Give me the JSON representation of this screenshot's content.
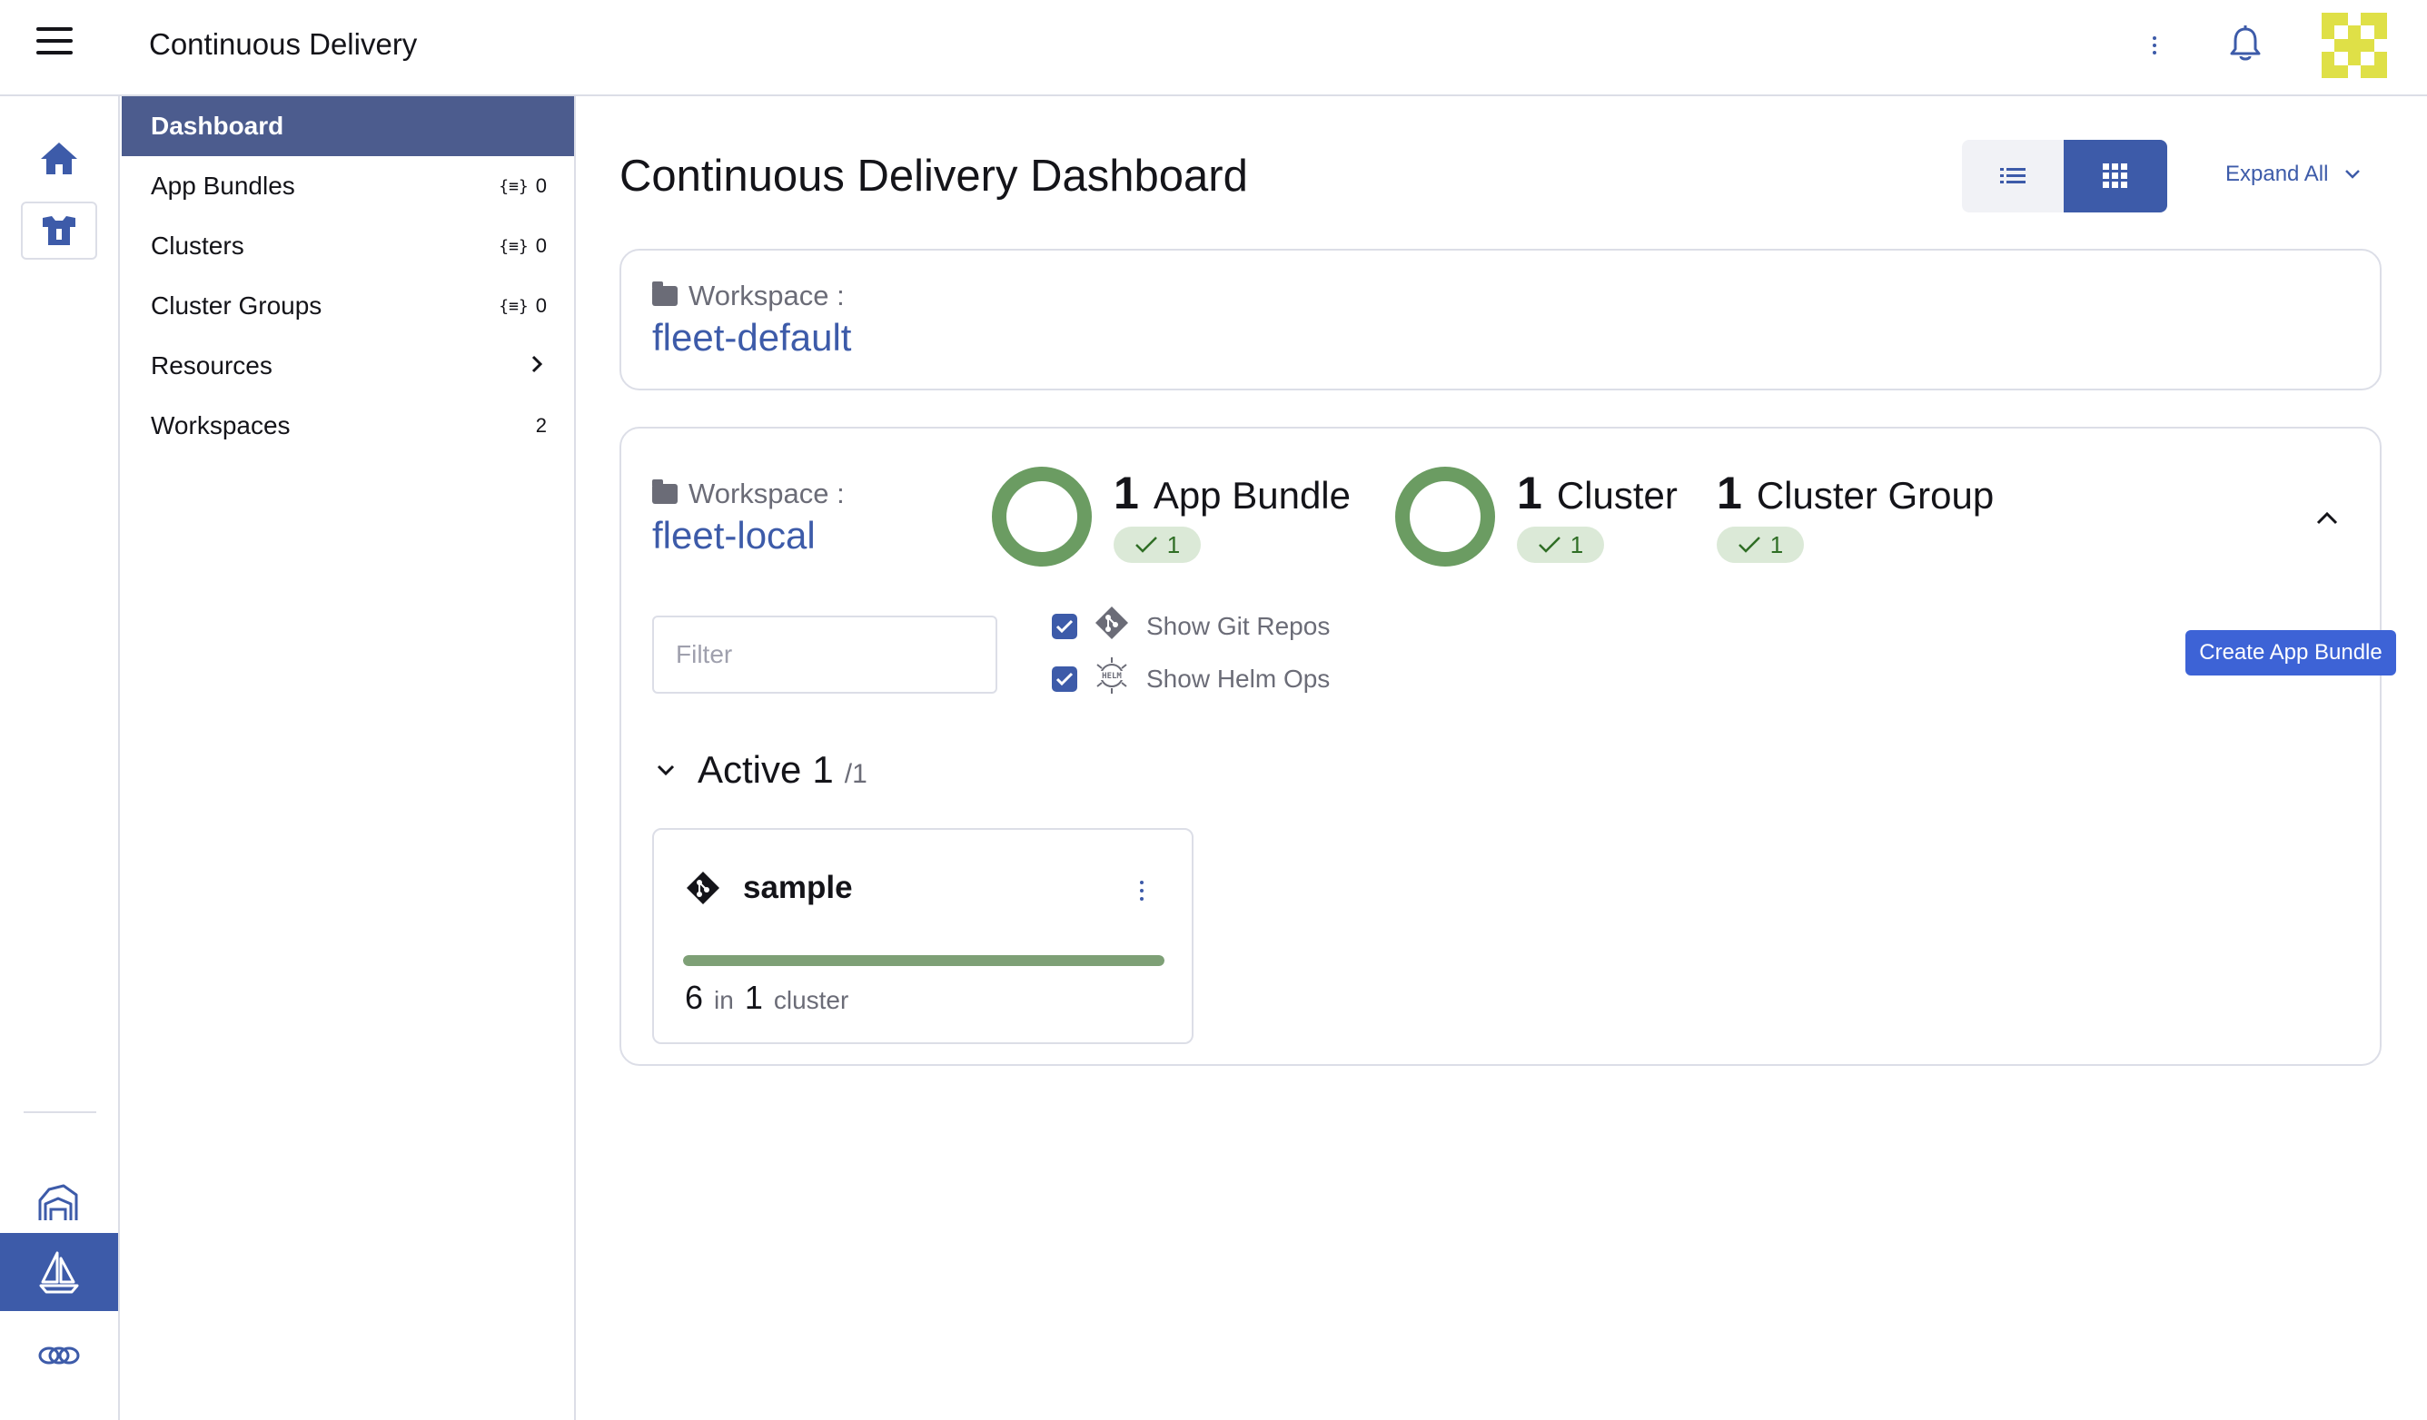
{
  "header": {
    "product_title": "Continuous Delivery",
    "menu_icon": "hamburger-icon",
    "notifications_icon": "bell-icon",
    "avatar_colors": [
      "#dfe047",
      "#ffffff"
    ]
  },
  "rail": {
    "items": [
      {
        "name": "home",
        "icon": "home-icon"
      },
      {
        "name": "fleet",
        "icon": "fleet-icon"
      },
      {
        "name": "cluster-explorer",
        "icon": "barn-icon"
      },
      {
        "name": "continuous-delivery",
        "icon": "sailboat-icon",
        "active": true
      },
      {
        "name": "extensions",
        "icon": "links-icon"
      }
    ]
  },
  "sidenav": {
    "items": [
      {
        "label": "Dashboard",
        "active": true
      },
      {
        "label": "App Bundles",
        "ns_icon": "{≡}",
        "count": "0"
      },
      {
        "label": "Clusters",
        "ns_icon": "{≡}",
        "count": "0"
      },
      {
        "label": "Cluster Groups",
        "ns_icon": "{≡}",
        "count": "0"
      },
      {
        "label": "Resources",
        "chevron": "chevron-right-icon"
      },
      {
        "label": "Workspaces",
        "count": "2"
      }
    ]
  },
  "main": {
    "title": "Continuous Delivery Dashboard",
    "expand_all": "Expand All",
    "view_toggle": {
      "selected": "grid"
    },
    "workspaces": [
      {
        "label": "Workspace :",
        "name": "fleet-default"
      },
      {
        "label": "Workspace :",
        "name": "fleet-local",
        "stats": [
          {
            "count": "1",
            "label": "App Bundle",
            "ready": "1",
            "ring": true
          },
          {
            "count": "1",
            "label": "Cluster",
            "ready": "1",
            "ring": true
          },
          {
            "count": "1",
            "label": "Cluster Group",
            "ready": "1",
            "ring": false
          }
        ],
        "filter_placeholder": "Filter",
        "filter_value": "",
        "show_git_repos": "Show Git Repos",
        "show_helm_ops": "Show Helm Ops",
        "show_git_checked": true,
        "show_helm_checked": true,
        "create_button": "Create App Bundle",
        "active_group": {
          "title": "Active",
          "count": "1",
          "total": "/1"
        },
        "app_cards": [
          {
            "name": "sample",
            "type_icon": "git-icon",
            "progress": 1.0,
            "resources": "6",
            "in_text": "in",
            "clusters": "1",
            "cluster_text": "cluster"
          }
        ]
      }
    ]
  },
  "colors": {
    "accent": "#3d5ba9",
    "nav_active": "#4c5c8e",
    "success": "#6b9c62",
    "success_bg": "#dbe9d7",
    "button": "#3d63d6"
  }
}
